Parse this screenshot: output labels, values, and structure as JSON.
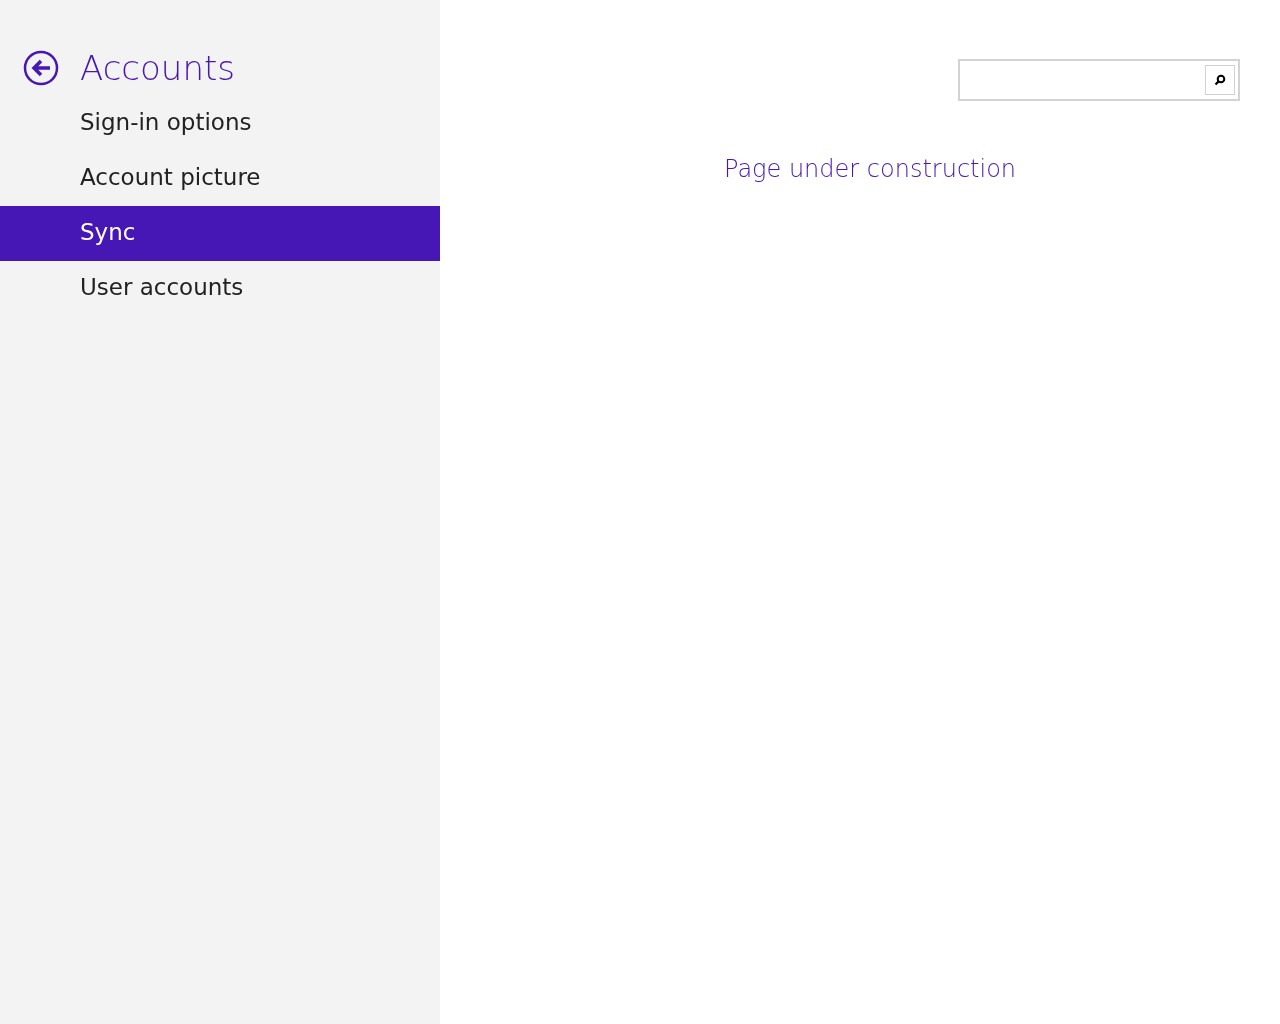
{
  "sidebar": {
    "title": "Accounts",
    "items": [
      {
        "label": "Sign-in options",
        "selected": false
      },
      {
        "label": "Account picture",
        "selected": false
      },
      {
        "label": "Sync",
        "selected": true
      },
      {
        "label": "User accounts",
        "selected": false
      }
    ]
  },
  "main": {
    "message": "Page under construction"
  }
}
